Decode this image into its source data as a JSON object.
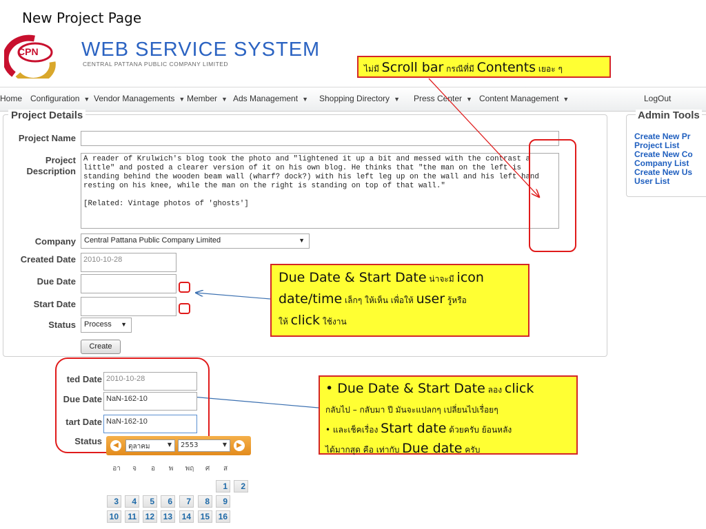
{
  "slide_title": "New Project Page",
  "logo": {
    "badge": "CPN",
    "title": "WEB SERVICE SYSTEM",
    "subtitle": "CENTRAL PATTANA PUBLIC COMPANY LIMITED"
  },
  "nav": [
    {
      "label": "Home",
      "dropdown": false
    },
    {
      "label": "Configuration",
      "dropdown": true
    },
    {
      "label": "Vendor Managements",
      "dropdown": true
    },
    {
      "label": "Member",
      "dropdown": true
    },
    {
      "label": "Ads Management",
      "dropdown": true
    },
    {
      "label": "Shopping Directory",
      "dropdown": true
    },
    {
      "label": "Press Center",
      "dropdown": true
    },
    {
      "label": "Content Management",
      "dropdown": true
    },
    {
      "label": "LogOut",
      "dropdown": false
    }
  ],
  "form": {
    "legend": "Project Details",
    "project_name_label": "Project Name",
    "project_name_value": "",
    "description_label": "Project Description",
    "description_value": "A reader of Krulwich's blog took the photo and \"lightened it up a bit and messed with the contrast a little\" and posted a clearer version of it on his own blog. He thinks that \"the man on the left is standing behind the wooden beam wall (wharf? dock?) with his left leg up on the wall and his left hand resting on his knee, while the man on the right is standing on top of that wall.\"\n\n[Related: Vintage photos of 'ghosts']",
    "company_label": "Company",
    "company_value": "Central Pattana Public Company Limited",
    "created_label": "Created Date",
    "created_value": "2010-10-28",
    "due_label": "Due Date",
    "due_value": "",
    "start_label": "Start Date",
    "start_value": "",
    "status_label": "Status",
    "status_value": "Process",
    "create_button": "Create"
  },
  "admin_tools": {
    "title": "Admin Tools",
    "links": [
      "Create New Pr",
      "Project List",
      "Create New Co",
      "Company List",
      "Create New Us",
      "User List"
    ]
  },
  "callouts": {
    "scrollbar": [
      "ไม่มี ",
      "Scroll bar",
      " กรณีที่มี ",
      "Contents",
      " เยอะ ๆ"
    ],
    "date_icon": [
      "Due Date & Start Date",
      " น่าจะมี ",
      "icon",
      "date/time",
      " เล็กๆ ให้เห็น เพื่อให้ ",
      "user",
      " รู้หรือ",
      "ให้ ",
      "click",
      " ใช้งาน"
    ],
    "date_click": [
      "• Due Date & Start Date",
      " ลอง ",
      "click",
      "กลับไป – กลับมา ปี มันจะแปลกๆ เปลี่ยนไปเรื่อยๆ",
      "• และเช็คเรื่อง ",
      "Start date",
      " ด้วยครับ ย้อนหลัง",
      "ได้มากสุด คือ เท่ากับ ",
      "Due date",
      " ครับ"
    ]
  },
  "zoom": {
    "created_label": "ted Date",
    "created_value": "2010-10-28",
    "due_label": "Due Date",
    "due_value": "NaN-162-10",
    "start_label": "tart Date",
    "start_value": "NaN-162-10",
    "status_label": "Status"
  },
  "calendar": {
    "prev": "◀",
    "next": "▶",
    "month": "ตุลาคม",
    "year": "2553",
    "weekdays": [
      "อา",
      "จ",
      "อ",
      "พ",
      "พฤ",
      "ศ",
      "ส"
    ],
    "row1": [
      "1",
      "2"
    ],
    "row2": [
      "3",
      "4",
      "5",
      "6",
      "7",
      "8",
      "9"
    ],
    "row3": [
      "10",
      "11",
      "12",
      "13",
      "14",
      "15",
      "16"
    ]
  }
}
